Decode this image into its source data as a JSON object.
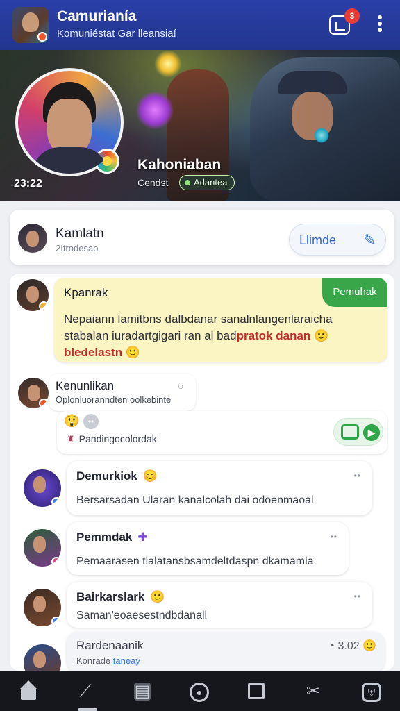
{
  "header": {
    "title": "Camurianía",
    "subtitle": "Komuniéstat Gar lleansiaí",
    "notification_count": "3",
    "icons": [
      "app-avatar",
      "notification-icon",
      "more-vert-icon"
    ]
  },
  "banner": {
    "time": "23:22",
    "name": "Kahoniaban",
    "status_label": "Cendst",
    "status_chip": "Adantea",
    "icons": [
      "rank-badge-icon"
    ]
  },
  "profile_card": {
    "name": "Kamlatn",
    "sub": "2Itrodesao",
    "action_label": "Llimde",
    "icons": [
      "pin-icon"
    ]
  },
  "feed": {
    "highlight": {
      "title": "Kpanrak",
      "tag": "Pemuhak",
      "body_plain": "Nepaiann lamitbns dalbdanar sanalnlangenlaraicha stabalan iuradartgigari ran al bad",
      "body_alert": "pratok danan 🙂 bledelastn",
      "body_end": " 🙂"
    },
    "reply": {
      "title": "Kenunlikan",
      "sub": "Oplonluoranndten oolkebinte",
      "reaction_meta": "Pandingocolordak"
    },
    "messages": [
      {
        "title": "Demurkiok",
        "emoji": "😊",
        "body": "Bersarsadan Ularan kanalcolah dai odoenmaoal"
      },
      {
        "title": "Pemmdak",
        "emoji": "✚",
        "body": "Pemaarasen tlalatansbsamdeltdaspn dkamamia"
      },
      {
        "title": "Bairkarslark",
        "emoji": "🙂",
        "body": "Saman'eoaesestndbdanall"
      },
      {
        "title": "Rardenaanik",
        "sub": "Konrade",
        "link": "taneay",
        "time": "3.02",
        "emoji": "🙂"
      }
    ]
  },
  "colors": {
    "header_bg": "#2a3fa8",
    "highlight_bg": "#fbf4c3",
    "tag_green": "#3aa64a",
    "alert_red": "#c42a2a",
    "nav_bg": "#15171c"
  },
  "bottom_nav": {
    "icons": [
      "home-icon",
      "explore-icon",
      "library-icon",
      "record-icon",
      "square-icon",
      "cut-icon",
      "shield-icon"
    ]
  }
}
